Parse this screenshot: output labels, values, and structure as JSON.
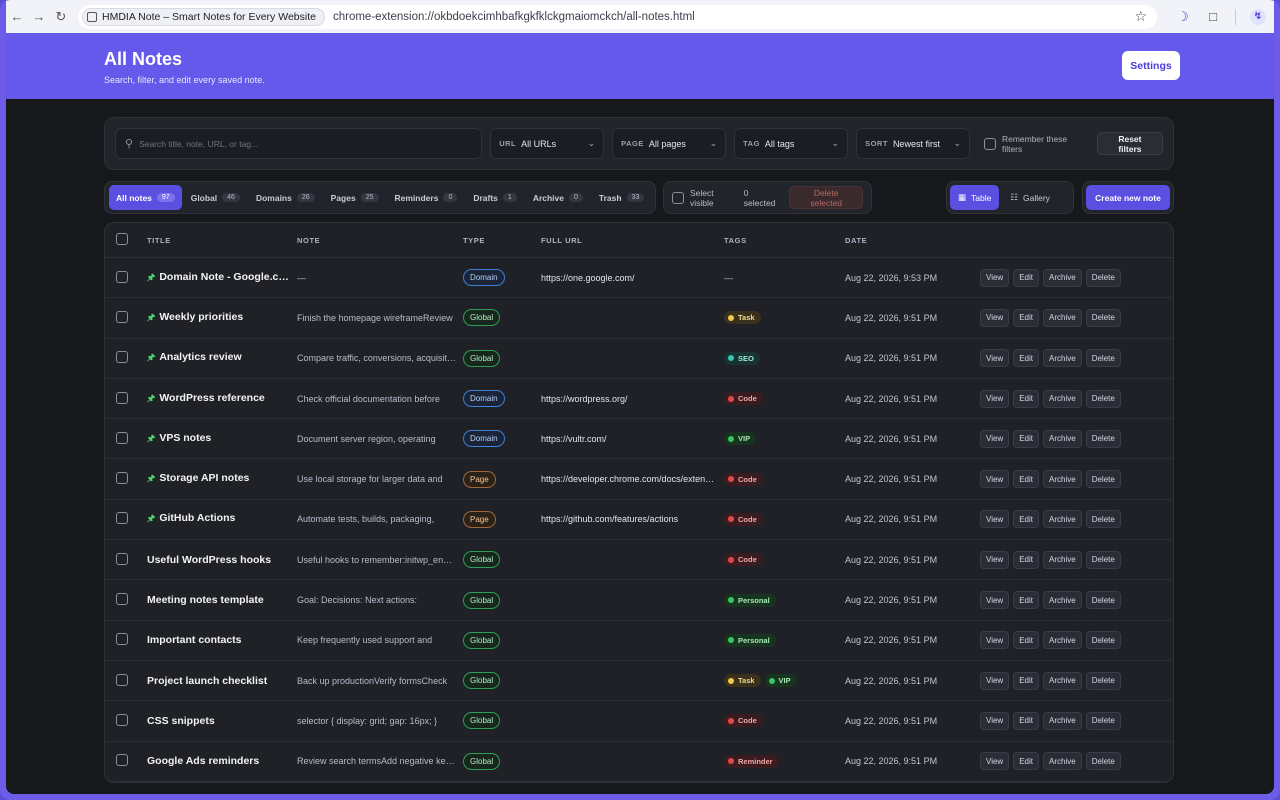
{
  "browser": {
    "tab_title": "HMDIA Note – Smart Notes for Every Website",
    "url": "chrome-extension://okbdoekcimhbafkgkfklckgmaiomckch/all-notes.html"
  },
  "header": {
    "title": "All Notes",
    "subtitle": "Search, filter, and edit every saved note.",
    "settings_label": "Settings"
  },
  "filters": {
    "search_placeholder": "Search title, note, URL, or tag...",
    "url_label": "URL",
    "url_value": "All URLs",
    "page_label": "PAGE",
    "page_value": "All pages",
    "tag_label": "TAG",
    "tag_value": "All tags",
    "sort_label": "SORT",
    "sort_value": "Newest first",
    "remember_label": "Remember these filters",
    "reset_label": "Reset filters"
  },
  "tabs": [
    {
      "label": "All notes",
      "count": "97"
    },
    {
      "label": "Global",
      "count": "46"
    },
    {
      "label": "Domains",
      "count": "26"
    },
    {
      "label": "Pages",
      "count": "25"
    },
    {
      "label": "Reminders",
      "count": "0"
    },
    {
      "label": "Drafts",
      "count": "1"
    },
    {
      "label": "Archive",
      "count": "0"
    },
    {
      "label": "Trash",
      "count": "33"
    }
  ],
  "selection": {
    "select_visible": "Select visible",
    "selected_count": "0 selected",
    "delete_selected": "Delete selected"
  },
  "view": {
    "table": "Table",
    "gallery": "Gallery",
    "create": "Create new note"
  },
  "columns": {
    "title": "TITLE",
    "note": "NOTE",
    "type": "TYPE",
    "url": "FULL URL",
    "tags": "TAGS",
    "date": "DATE"
  },
  "actions": {
    "view": "View",
    "edit": "Edit",
    "archive": "Archive",
    "delete": "Delete"
  },
  "rows": [
    {
      "pinned": true,
      "title": "Domain Note - Google.com",
      "note": "—",
      "type": "Domain",
      "url": "https://one.google.com/",
      "tags": [],
      "tags_empty": "—",
      "date": "Aug 22, 2026, 9:53 PM"
    },
    {
      "pinned": true,
      "title": "Weekly priorities",
      "note": "Finish the homepage wireframeReview",
      "type": "Global",
      "url": "",
      "tags": [
        "Task"
      ],
      "date": "Aug 22, 2026, 9:51 PM"
    },
    {
      "pinned": true,
      "title": "Analytics review",
      "note": "Compare traffic, conversions, acquisition",
      "type": "Global",
      "url": "",
      "tags": [
        "SEO"
      ],
      "date": "Aug 22, 2026, 9:51 PM"
    },
    {
      "pinned": true,
      "title": "WordPress reference",
      "note": "Check official documentation before",
      "type": "Domain",
      "url": "https://wordpress.org/",
      "tags": [
        "Code"
      ],
      "date": "Aug 22, 2026, 9:51 PM"
    },
    {
      "pinned": true,
      "title": "VPS notes",
      "note": "Document server region, operating",
      "type": "Domain",
      "url": "https://vultr.com/",
      "tags": [
        "VIP"
      ],
      "date": "Aug 22, 2026, 9:51 PM"
    },
    {
      "pinned": true,
      "title": "Storage API notes",
      "note": "Use local storage for larger data and",
      "type": "Page",
      "url": "https://developer.chrome.com/docs/extensions",
      "tags": [
        "Code"
      ],
      "date": "Aug 22, 2026, 9:51 PM"
    },
    {
      "pinned": true,
      "title": "GitHub Actions",
      "note": "Automate tests, builds, packaging,",
      "type": "Page",
      "url": "https://github.com/features/actions",
      "tags": [
        "Code"
      ],
      "date": "Aug 22, 2026, 9:51 PM"
    },
    {
      "pinned": false,
      "title": "Useful WordPress hooks",
      "note": "Useful hooks to remember:initwp_enqueue",
      "type": "Global",
      "url": "",
      "tags": [
        "Code"
      ],
      "date": "Aug 22, 2026, 9:51 PM"
    },
    {
      "pinned": false,
      "title": "Meeting notes template",
      "note": "Goal: Decisions: Next actions:",
      "type": "Global",
      "url": "",
      "tags": [
        "Personal"
      ],
      "date": "Aug 22, 2026, 9:51 PM"
    },
    {
      "pinned": false,
      "title": "Important contacts",
      "note": "Keep frequently used support and",
      "type": "Global",
      "url": "",
      "tags": [
        "Personal"
      ],
      "date": "Aug 22, 2026, 9:51 PM"
    },
    {
      "pinned": false,
      "title": "Project launch checklist",
      "note": "Back up productionVerify formsCheck",
      "type": "Global",
      "url": "",
      "tags": [
        "Task",
        "VIP"
      ],
      "date": "Aug 22, 2026, 9:51 PM"
    },
    {
      "pinned": false,
      "title": "CSS snippets",
      "note": "selector { display: grid; gap: 16px; }",
      "type": "Global",
      "url": "",
      "tags": [
        "Code"
      ],
      "date": "Aug 22, 2026, 9:51 PM"
    },
    {
      "pinned": false,
      "title": "Google Ads reminders",
      "note": "Review search termsAdd negative keywords",
      "type": "Global",
      "url": "",
      "tags": [
        "Reminder"
      ],
      "date": "Aug 22, 2026, 9:51 PM"
    }
  ]
}
